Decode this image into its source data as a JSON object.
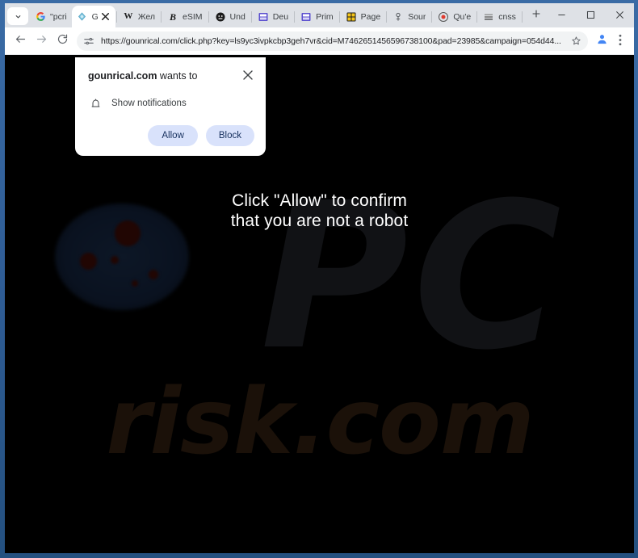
{
  "window": {
    "controls": [
      {
        "name": "minimize",
        "glyph": "–"
      },
      {
        "name": "maximize",
        "glyph": "□"
      },
      {
        "name": "close",
        "glyph": "✕"
      }
    ]
  },
  "tabstrip": {
    "tab_search_icon": "chevron-down-icon",
    "new_tab_label": "+",
    "tabs": [
      {
        "title": "\"pcri",
        "favicon": "G",
        "favicon_kind": "google",
        "active": false
      },
      {
        "title": "G",
        "favicon": "◆",
        "favicon_kind": "teal-gem",
        "active": true,
        "close": "✕"
      },
      {
        "title": "Жел",
        "favicon": "W",
        "favicon_kind": "wikipedia",
        "active": false
      },
      {
        "title": "eSIM",
        "favicon": "B",
        "favicon_kind": "bold-b",
        "active": false
      },
      {
        "title": "Und",
        "favicon": "●",
        "favicon_kind": "dark-face",
        "active": false
      },
      {
        "title": "Deu",
        "favicon": "▦",
        "favicon_kind": "purple-doc",
        "active": false
      },
      {
        "title": "Prim",
        "favicon": "▦",
        "favicon_kind": "purple-doc",
        "active": false
      },
      {
        "title": "Page",
        "favicon": "▣",
        "favicon_kind": "yellow-puzzle",
        "active": false
      },
      {
        "title": "Sour",
        "favicon": "♀",
        "favicon_kind": "grey-pin",
        "active": false
      },
      {
        "title": "Qu'e",
        "favicon": "◉",
        "favicon_kind": "red-target",
        "active": false
      },
      {
        "title": "cnss",
        "favicon": "☷",
        "favicon_kind": "grey-lines",
        "active": false
      }
    ]
  },
  "toolbar": {
    "back_icon": "back-arrow-icon",
    "forward_icon": "forward-arrow-icon",
    "reload_icon": "reload-icon",
    "site_info_icon": "tune-settings-icon",
    "url": "https://gounrical.com/click.php?key=ls9yc3ivpkcbp3geh7vr&cid=M7462651456596738100&pad=23985&campaign=054d44...",
    "bookmark_icon": "star-icon",
    "profile_icon": "avatar-icon",
    "menu_icon": "three-dot-menu-icon"
  },
  "permission_dialog": {
    "origin": "gounrical.com",
    "title_suffix": " wants to",
    "close_icon": "close-icon",
    "permission_icon": "bell-icon",
    "permission_label": "Show notifications",
    "allow_label": "Allow",
    "block_label": "Block",
    "button_bg": "#d9e2fb",
    "button_text_color": "#16305e"
  },
  "page": {
    "background_color": "#000000",
    "headline_line1": "Click \"Allow\" to confirm",
    "headline_line2": "that you are not a robot",
    "headline_color": "#ffffff",
    "watermark_pc": "PC",
    "watermark_risk": "risk.com"
  }
}
